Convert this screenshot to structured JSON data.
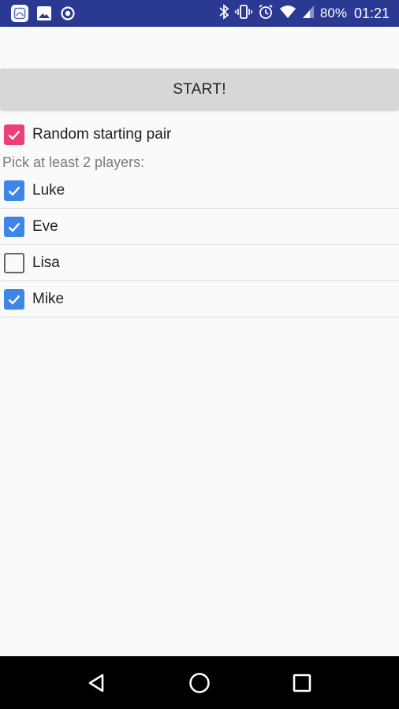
{
  "status_bar": {
    "battery": "80%",
    "time": "01:21",
    "left_icons": [
      "app-notification-icon",
      "image-notification-icon",
      "circle-notification-icon"
    ],
    "right_icons": [
      "bluetooth-icon",
      "vibrate-icon",
      "alarm-icon",
      "wifi-icon",
      "cell-signal-icon"
    ],
    "background": "#2a3a93"
  },
  "start_button": {
    "label": "START!"
  },
  "random_pair": {
    "label": "Random starting pair",
    "checked": true,
    "color": "#ee3e7a"
  },
  "players": {
    "prompt": "Pick at least 2 players:",
    "items": [
      {
        "name": "Luke",
        "checked": true
      },
      {
        "name": "Eve",
        "checked": true
      },
      {
        "name": "Lisa",
        "checked": false
      },
      {
        "name": "Mike",
        "checked": true
      }
    ],
    "check_color": "#3d86e6"
  },
  "nav_bar": {
    "icons": [
      "back-icon",
      "home-icon",
      "recents-icon"
    ]
  }
}
